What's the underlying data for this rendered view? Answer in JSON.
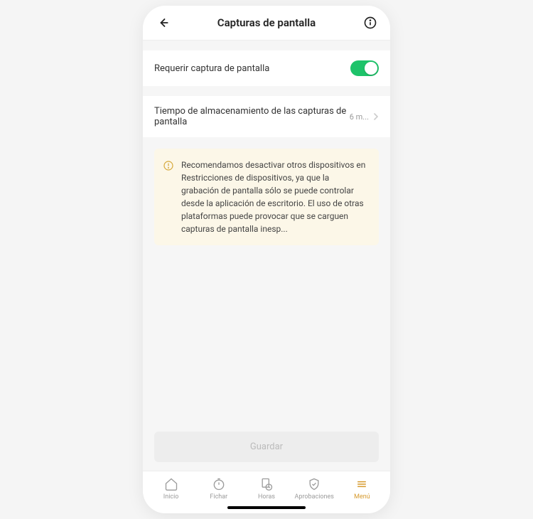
{
  "header": {
    "title": "Capturas de pantalla"
  },
  "rows": {
    "require": {
      "label": "Requerir captura de pantalla"
    },
    "storage": {
      "label": "Tiempo de almacenamiento de las capturas de pantalla",
      "value": "6 m..."
    }
  },
  "notice": {
    "text": "Recomendamos desactivar otros dispositivos en Restricciones de dispositivos, ya que la grabación de pantalla sólo se puede controlar desde la aplicación de escritorio. El uso de otras plataformas puede provocar que se carguen capturas de pantalla inesp..."
  },
  "save_label": "Guardar",
  "tabs": {
    "home": "Inicio",
    "clock": "Fichar",
    "hours": "Horas",
    "approvals": "Aprobaciones",
    "menu": "Menú"
  }
}
